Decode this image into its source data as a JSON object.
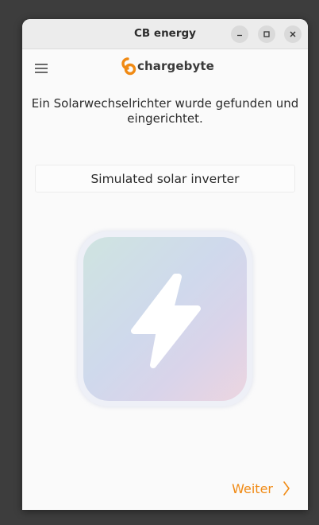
{
  "window": {
    "title": "CB energy"
  },
  "header": {
    "brand": "chargebyte"
  },
  "main": {
    "message": "Ein Solarwechselrichter wurde gefunden und eingerichtet.",
    "device_name": "Simulated solar inverter"
  },
  "footer": {
    "next_label": "Weiter"
  },
  "icons": {
    "menu": "hamburger-menu-icon",
    "logo": "chargebyte-logo-icon",
    "device": "lightning-bolt-icon",
    "next": "chevron-right-icon"
  },
  "colors": {
    "accent": "#f08a14",
    "window_bg": "#fafafa",
    "desktop": "#3d3d3d"
  }
}
